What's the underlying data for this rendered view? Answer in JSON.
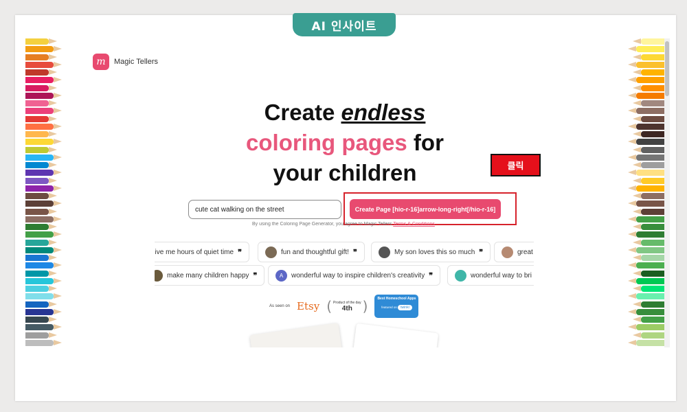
{
  "overlay": {
    "tag": "AI 인사이트",
    "click_badge": "클릭"
  },
  "header": {
    "logo_mark": "m",
    "brand": "Magic Tellers"
  },
  "hero": {
    "line1_a": "Create ",
    "line1_em": "endless",
    "line2_pink": "coloring pages",
    "line2_b": " for",
    "line3": "your children"
  },
  "search": {
    "value": "cute cat walking on the street",
    "button_label": "Create Page [hio-r-16]arrow-long-right[/hio-r-16]",
    "terms_text": "By using the Coloring Page Generator, you agree to Magic Tellers ",
    "terms_link": "Terms & Conditions"
  },
  "testimonials": {
    "row1": [
      {
        "text": "give me hours of quiet time",
        "avatar": "none"
      },
      {
        "text": "fun and thoughtful gift!",
        "avatar": "photo"
      },
      {
        "text": "My son loves this so much",
        "avatar": "photo"
      },
      {
        "text": "great",
        "avatar": "photo"
      }
    ],
    "row2": [
      {
        "text": "make many children happy",
        "avatar": "photo"
      },
      {
        "text": "wonderful way to inspire children's creativity",
        "avatar": "A"
      },
      {
        "text": "wonderful way to bri",
        "avatar": "photo"
      }
    ],
    "quote_mark": "❞"
  },
  "press": {
    "label": "As seen on",
    "etsy": "Etsy",
    "potd_label": "Product of the day",
    "potd_rank": "4th",
    "app_title": "Best Homeschool Apps",
    "app_featured": "featured on",
    "app_site": "twinkl"
  },
  "colors": {
    "brand": "#e84a6f",
    "accent_pink": "#e8577c",
    "highlight_red": "#d6222b",
    "tag_teal": "#3a9e92"
  }
}
